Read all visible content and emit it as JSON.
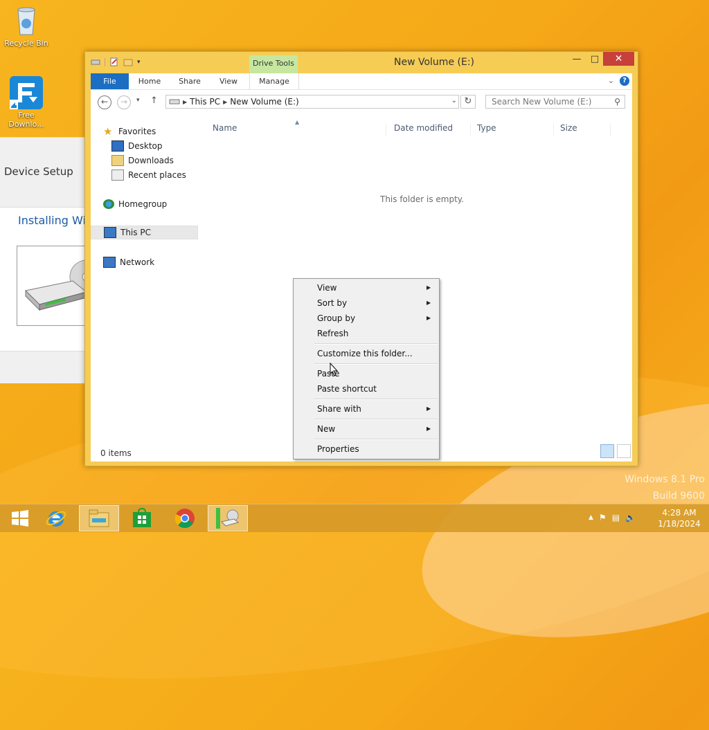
{
  "desktop": {
    "icons": [
      {
        "label": "Recycle Bin"
      },
      {
        "label": "Free Downlo..."
      }
    ],
    "watermark": {
      "line1": "Windows 8.1 Pro",
      "line2": "Build 9600"
    }
  },
  "device_setup": {
    "title": "Device Setup",
    "installing": "Installing Wi"
  },
  "explorer": {
    "title": "New Volume (E:)",
    "contextual_tab_group": "Drive Tools",
    "ribbon_tabs": {
      "file": "File",
      "home": "Home",
      "share": "Share",
      "view": "View",
      "manage": "Manage"
    },
    "address": {
      "seg1": "This PC",
      "seg2": "New Volume (E:)"
    },
    "search_placeholder": "Search New Volume (E:)",
    "nav": {
      "favorites": "Favorites",
      "desktop": "Desktop",
      "downloads": "Downloads",
      "recent": "Recent places",
      "homegroup": "Homegroup",
      "thispc": "This PC",
      "network": "Network"
    },
    "columns": {
      "name": "Name",
      "date": "Date modified",
      "type": "Type",
      "size": "Size"
    },
    "empty_message": "This folder is empty.",
    "status": "0 items"
  },
  "context_menu": {
    "view": "View",
    "sortby": "Sort by",
    "groupby": "Group by",
    "refresh": "Refresh",
    "customize": "Customize this folder...",
    "paste": "Paste",
    "paste_shortcut": "Paste shortcut",
    "share_with": "Share with",
    "new": "New",
    "properties": "Properties"
  },
  "taskbar": {
    "time": "4:28 AM",
    "date": "1/18/2024"
  },
  "colors": {
    "accent": "#1b6ec2",
    "drive_tools": "#c7e7a0",
    "close": "#c7403a",
    "desktop": "#f5a818"
  }
}
